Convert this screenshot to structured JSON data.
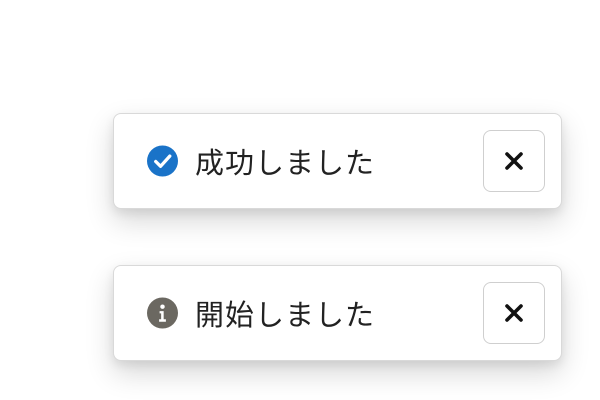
{
  "toasts": [
    {
      "message": "成功しました",
      "icon": "check-circle-icon",
      "icon_color": "#1a73c8",
      "close_icon": "close-icon"
    },
    {
      "message": "開始しました",
      "icon": "info-circle-icon",
      "icon_color": "#6b6861",
      "close_icon": "close-icon"
    }
  ]
}
